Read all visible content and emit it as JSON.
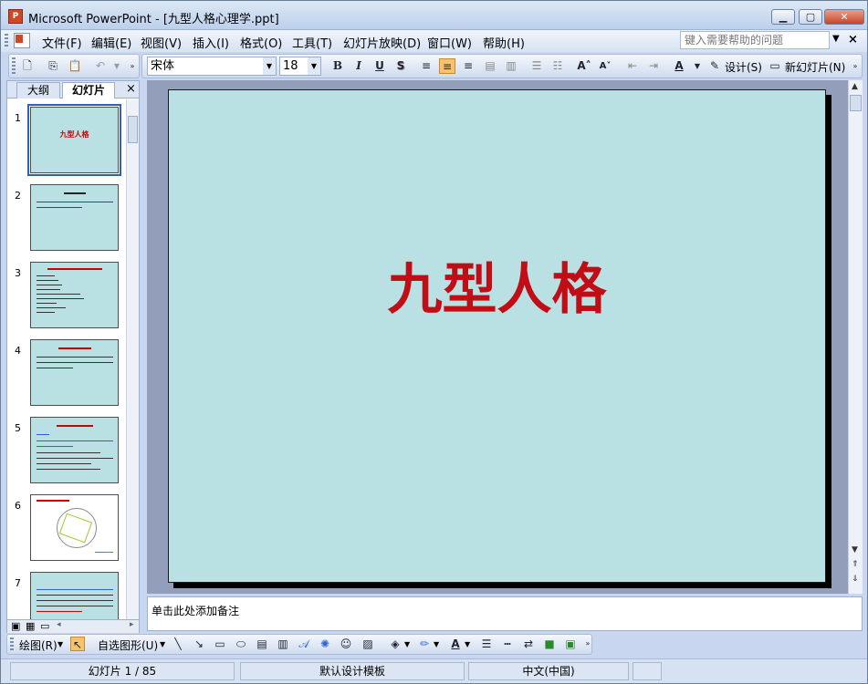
{
  "window": {
    "title": "Microsoft PowerPoint - [九型人格心理学.ppt]",
    "minimize_glyph": "▁",
    "maximize_glyph": "▢",
    "close_glyph": "✕"
  },
  "menu": {
    "items": [
      "文件(F)",
      "编辑(E)",
      "视图(V)",
      "插入(I)",
      "格式(O)",
      "工具(T)",
      "幻灯片放映(D)",
      "窗口(W)",
      "帮助(H)"
    ],
    "help_placeholder": "键入需要帮助的问题",
    "close_glyph": "×"
  },
  "toolbar": {
    "font_name": "宋体",
    "font_size": "18",
    "bold": "B",
    "italic": "I",
    "underline": "U",
    "shadow": "S",
    "design_label": "设计(S)",
    "new_slide_label": "新幻灯片(N)"
  },
  "panel": {
    "tab_outline": "大纲",
    "tab_slides": "幻灯片",
    "close_glyph": "×",
    "thumbnails": [
      {
        "num": "1",
        "title": "九型人格"
      },
      {
        "num": "2",
        "title": ""
      },
      {
        "num": "3",
        "title": ""
      },
      {
        "num": "4",
        "title": ""
      },
      {
        "num": "5",
        "title": ""
      },
      {
        "num": "6",
        "title": ""
      },
      {
        "num": "7",
        "title": ""
      }
    ]
  },
  "slide": {
    "title": "九型人格",
    "background": "#b9e0e3",
    "title_color": "#c10d15"
  },
  "notes": {
    "placeholder": "单击此处添加备注"
  },
  "drawing": {
    "draw_label": "绘图(R)",
    "autoshapes_label": "自选图形(U)"
  },
  "status": {
    "slide_position": "幻灯片 1 / 85",
    "template": "默认设计模板",
    "language": "中文(中国)"
  }
}
